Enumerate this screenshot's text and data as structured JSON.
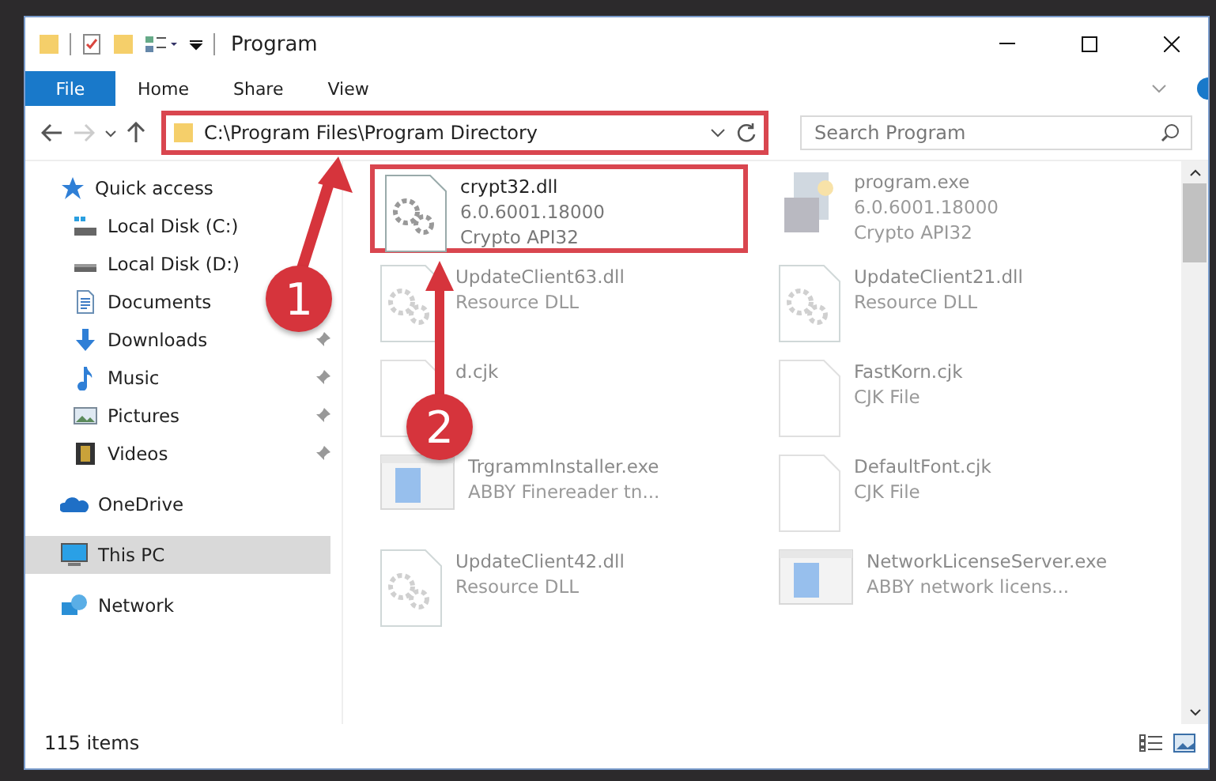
{
  "window": {
    "title": "Program"
  },
  "ribbon_tabs": [
    {
      "label": "File",
      "selected": true
    },
    {
      "label": "Home",
      "selected": false
    },
    {
      "label": "Share",
      "selected": false
    },
    {
      "label": "View",
      "selected": false
    }
  ],
  "address_bar": {
    "path": "C:\\Program Files\\Program Directory",
    "highlighted": true
  },
  "search": {
    "placeholder": "Search Program"
  },
  "sidebar": {
    "items": [
      {
        "label": "Quick access",
        "kind": "star",
        "selected": false,
        "pinned": false,
        "children": [
          {
            "label": "Local Disk (C:)",
            "kind": "system-drive",
            "selected": false,
            "pinned": false
          },
          {
            "label": "Local Disk (D:)",
            "kind": "drive",
            "selected": false,
            "pinned": false
          },
          {
            "label": "Documents",
            "kind": "documents",
            "selected": false,
            "pinned": false
          },
          {
            "label": "Downloads",
            "kind": "downloads",
            "selected": false,
            "pinned": true
          },
          {
            "label": "Music",
            "kind": "music",
            "selected": false,
            "pinned": true
          },
          {
            "label": "Pictures",
            "kind": "pictures",
            "selected": false,
            "pinned": true
          },
          {
            "label": "Videos",
            "kind": "videos",
            "selected": false,
            "pinned": true
          }
        ]
      },
      {
        "label": "OneDrive",
        "kind": "cloud",
        "selected": false,
        "pinned": false
      },
      {
        "label": "This PC",
        "kind": "computer",
        "selected": true,
        "pinned": false
      },
      {
        "label": "Network",
        "kind": "network",
        "selected": false,
        "pinned": false
      }
    ]
  },
  "files": [
    {
      "name": "crypt32.dll",
      "details": [
        "6.0.6001.18000",
        "Crypto API32"
      ],
      "kind": "dll",
      "highlighted": true
    },
    {
      "name": "program.exe",
      "details": [
        "6.0.6001.18000",
        "Crypto API32"
      ],
      "kind": "exe",
      "highlighted": false
    },
    {
      "name": "UpdateClient63.dll",
      "details": [
        "Resource DLL"
      ],
      "kind": "dll",
      "highlighted": false
    },
    {
      "name": "UpdateClient21.dll",
      "details": [
        "Resource DLL"
      ],
      "kind": "dll",
      "highlighted": false
    },
    {
      "name": "d.cjk",
      "kind": "cjk",
      "highlighted": false
    },
    {
      "name": "FastKorn.cjk",
      "details": [
        "CJK File"
      ],
      "kind": "cjk",
      "highlighted": false
    },
    {
      "name": "TrgrammInstaller.exe",
      "details": [
        "ABBY Finereader tn..."
      ],
      "kind": "installer",
      "highlighted": false
    },
    {
      "name": "DefaultFont.cjk",
      "details": [
        "CJK File"
      ],
      "kind": "cjk",
      "highlighted": false
    },
    {
      "name": "UpdateClient42.dll",
      "details": [
        "Resource DLL"
      ],
      "kind": "dll",
      "highlighted": false
    },
    {
      "name": "NetworkLicenseServer.exe",
      "details": [
        "ABBY network licens..."
      ],
      "kind": "installer",
      "highlighted": false
    }
  ],
  "status_bar": {
    "item_count": "115 items"
  },
  "annotations": [
    {
      "label": "1"
    },
    {
      "label": "2"
    }
  ]
}
